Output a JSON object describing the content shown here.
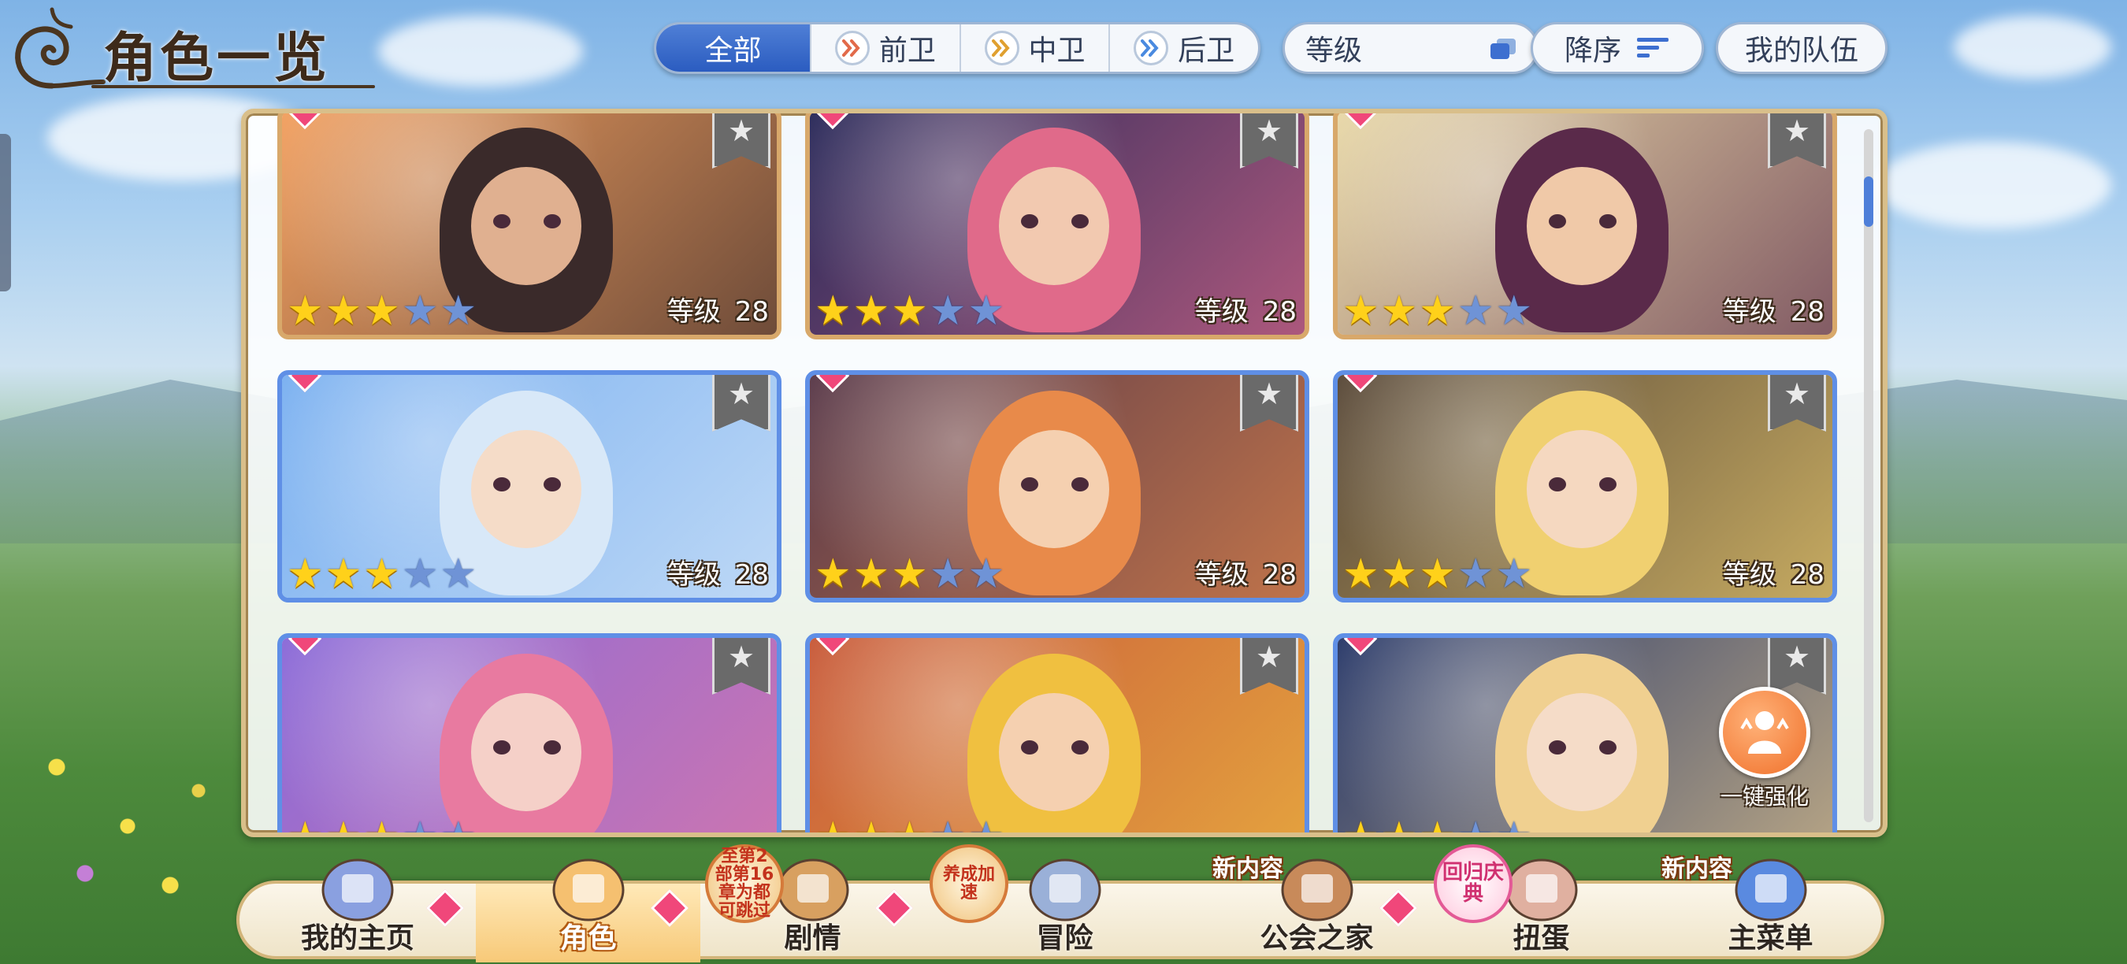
{
  "screen_title": "角色一览",
  "filters": {
    "tabs": [
      {
        "label": "全部",
        "active": true
      },
      {
        "label": "前卫",
        "icon": "frontline-role-icon",
        "color": "#e26a4a"
      },
      {
        "label": "中卫",
        "icon": "midline-role-icon",
        "color": "#e0a030"
      },
      {
        "label": "后卫",
        "icon": "backline-role-icon",
        "color": "#4a8ae0"
      }
    ],
    "sort_field": "等级",
    "sort_order": "降序",
    "my_team": "我的队伍"
  },
  "level_label": "等级",
  "cards": [
    {
      "stars": 3,
      "max_stars": 5,
      "level": "28",
      "frame": "gold",
      "palette": [
        "#f2a060",
        "#3a2a2a",
        "#e0b090"
      ]
    },
    {
      "stars": 3,
      "max_stars": 5,
      "level": "28",
      "frame": "gold",
      "palette": [
        "#2a2a5a",
        "#e06a8a",
        "#f2c9b0"
      ]
    },
    {
      "stars": 3,
      "max_stars": 5,
      "level": "28",
      "frame": "gold",
      "palette": [
        "#e8d8a8",
        "#5a2a4a",
        "#f0c9a8"
      ]
    },
    {
      "stars": 3,
      "max_stars": 5,
      "level": "28",
      "frame": "blue",
      "palette": [
        "#7ab0f0",
        "#d8e8f8",
        "#f5dcc8"
      ]
    },
    {
      "stars": 3,
      "max_stars": 5,
      "level": "28",
      "frame": "blue",
      "palette": [
        "#5a3a4a",
        "#e88a4a",
        "#f5d0b0"
      ]
    },
    {
      "stars": 3,
      "max_stars": 5,
      "level": "28",
      "frame": "blue",
      "palette": [
        "#5a4a3a",
        "#f0d070",
        "#f5d8c0"
      ]
    },
    {
      "stars": 3,
      "max_stars": 5,
      "level": "",
      "frame": "blue",
      "palette": [
        "#8a6ad8",
        "#e87aa0",
        "#f5d0c8"
      ]
    },
    {
      "stars": 3,
      "max_stars": 5,
      "level": "",
      "frame": "blue",
      "palette": [
        "#c85a3a",
        "#f0c040",
        "#f5d0b0"
      ]
    },
    {
      "stars": 3,
      "max_stars": 5,
      "level": "",
      "frame": "blue",
      "palette": [
        "#2a3a6a",
        "#f0d090",
        "#f5dcc8"
      ]
    }
  ],
  "quick_enhance": "一键强化",
  "nav": [
    {
      "label": "我的主页",
      "icon": "castle-icon",
      "active": false,
      "gem": true
    },
    {
      "label": "角色",
      "icon": "character-icon",
      "active": true,
      "gem": true
    },
    {
      "label": "剧情",
      "icon": "scroll-icon",
      "active": false,
      "gem": true,
      "round_badge": "至第2部第16章为都可跳过"
    },
    {
      "label": "冒险",
      "icon": "sword-icon",
      "active": false,
      "gem": false,
      "round_badge": "养成加速"
    },
    {
      "label": "公会之家",
      "icon": "house-icon",
      "active": false,
      "gem": true,
      "badge": "新内容"
    },
    {
      "label": "扭蛋",
      "icon": "gacha-icon",
      "active": false,
      "gem": false,
      "round_badge": "回归庆典"
    },
    {
      "label": "主菜单",
      "icon": "crystal-icon",
      "active": false,
      "gem": false,
      "badge": "新内容"
    }
  ]
}
